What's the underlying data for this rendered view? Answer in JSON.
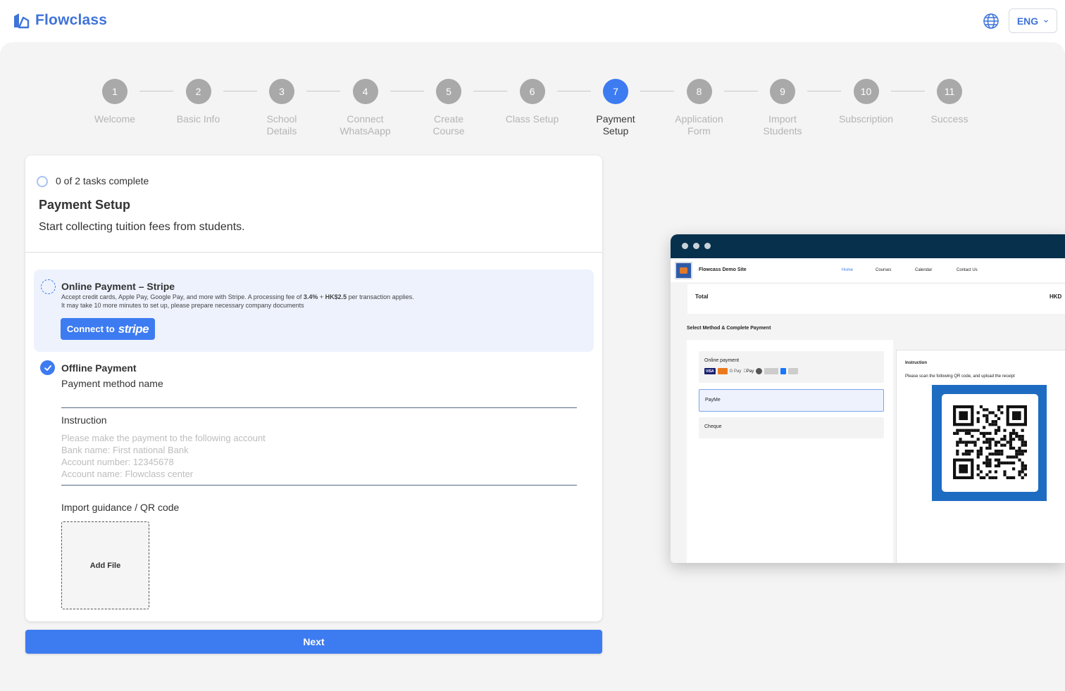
{
  "header": {
    "brand": "Flowclass",
    "language": "ENG"
  },
  "stepper": {
    "current": 7,
    "steps": [
      {
        "num": "1",
        "line1": "Welcome",
        "line2": ""
      },
      {
        "num": "2",
        "line1": "Basic Info",
        "line2": ""
      },
      {
        "num": "3",
        "line1": "School",
        "line2": "Details"
      },
      {
        "num": "4",
        "line1": "Connect",
        "line2": "WhatsAapp"
      },
      {
        "num": "5",
        "line1": "Create",
        "line2": "Course"
      },
      {
        "num": "6",
        "line1": "Class Setup",
        "line2": ""
      },
      {
        "num": "7",
        "line1": "Payment",
        "line2": "Setup"
      },
      {
        "num": "8",
        "line1": "Application",
        "line2": "Form"
      },
      {
        "num": "9",
        "line1": "Import",
        "line2": "Students"
      },
      {
        "num": "10",
        "line1": "Subscription",
        "line2": ""
      },
      {
        "num": "11",
        "line1": "Success",
        "line2": ""
      }
    ]
  },
  "card": {
    "tasks": "0 of 2 tasks complete",
    "title": "Payment Setup",
    "subtitle": "Start collecting tuition fees from students.",
    "stripe": {
      "title": "Online Payment – Stripe",
      "desc_prefix": "Accept credit cards, Apple Pay, Google Pay, and more with Stripe. A processing fee of ",
      "fee_percent": "3.4%",
      "fee_plus": " + ",
      "fee_fixed": "HK$2.5",
      "desc_suffix": " per transaction applies.",
      "note": "It may take 10 more minutes to set up, please prepare necessary company documents",
      "button_prefix": "Connect to",
      "button_brand": "stripe"
    },
    "offline": {
      "title": "Offline Payment",
      "method_label": "Payment method name",
      "method_value": "",
      "instruction_label": "Instruction",
      "instruction_placeholder": [
        "Please make the payment to the following account",
        "Bank name: First national Bank",
        "Account number: 12345678",
        "Account name: Flowclass center"
      ],
      "qr_label": "Import guidance / QR code",
      "add_file": "Add File"
    }
  },
  "next_button": "Next",
  "preview": {
    "site_name": "Flowcass Demo Site",
    "nav": [
      "Home",
      "Courses",
      "Calendar",
      "Contact Us"
    ],
    "total_label": "Total",
    "currency": "HKD",
    "select_label": "Select Method & Complete Payment",
    "options": [
      "Online payment",
      "PayMe",
      "Cheque"
    ],
    "pay_logos": [
      "VISA",
      "G Pay",
      "Pay"
    ],
    "instruction_title": "Instruction",
    "instruction_text": "Please scan the following QR code, and upload the receipt"
  },
  "colors": {
    "accent": "#3d7bf1",
    "brand": "#3f73d9",
    "preview_bar": "#07304d",
    "qr_frame": "#1e6cc2"
  }
}
